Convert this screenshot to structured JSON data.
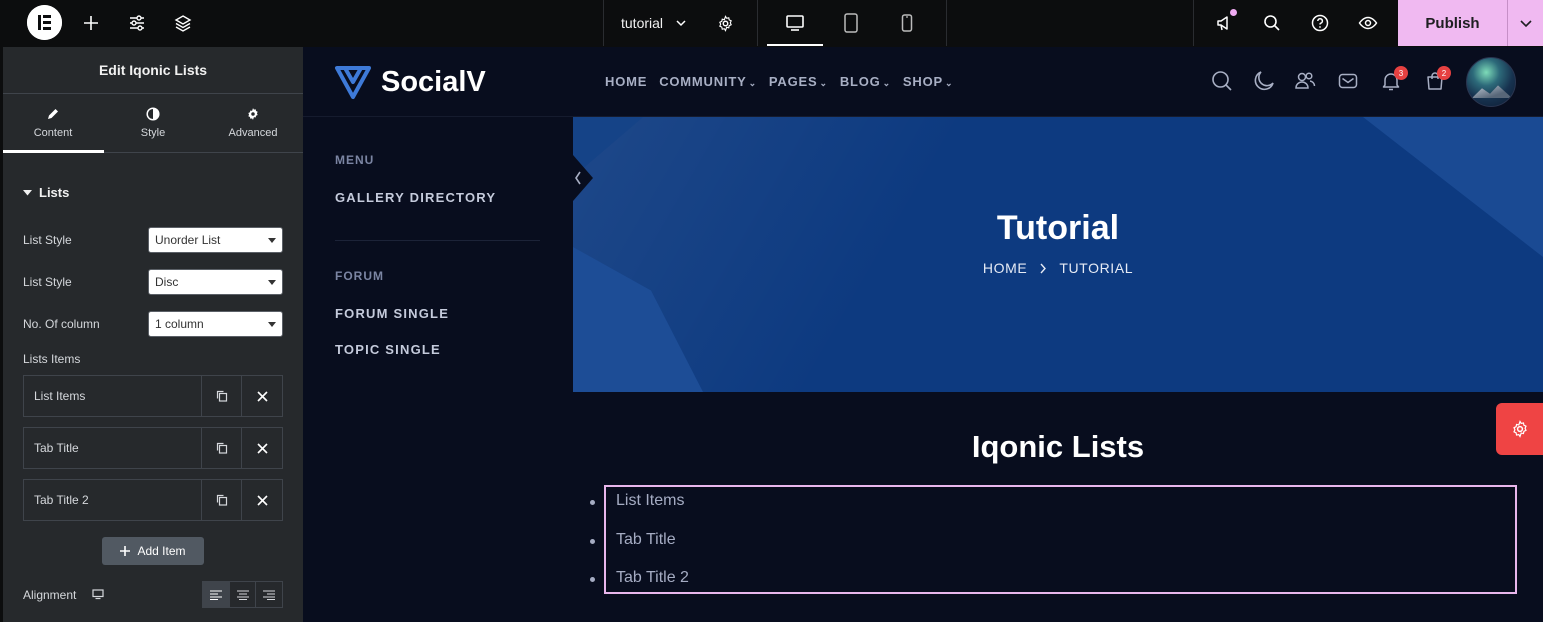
{
  "topbar": {
    "page_name": "tutorial",
    "publish_label": "Publish",
    "icons": [
      "elementor-logo-icon",
      "plus-icon",
      "sliders-icon",
      "layers-icon",
      "chevron-down-icon",
      "gear-icon",
      "desktop-icon",
      "tablet-icon",
      "mobile-icon",
      "megaphone-icon",
      "search-icon",
      "help-icon",
      "eye-icon"
    ]
  },
  "panel": {
    "title": "Edit Iqonic Lists",
    "tabs": [
      {
        "label": "Content",
        "icon": "pencil-icon"
      },
      {
        "label": "Style",
        "icon": "half-circle-icon"
      },
      {
        "label": "Advanced",
        "icon": "gear-icon"
      }
    ],
    "section": "Lists",
    "controls": [
      {
        "label": "List Style",
        "value": "Unorder List"
      },
      {
        "label": "List Style",
        "value": "Disc"
      },
      {
        "label": "No. Of column",
        "value": "1 column"
      }
    ],
    "items_label": "Lists Items",
    "items": [
      "List Items",
      "Tab Title",
      "Tab Title 2"
    ],
    "add_item_label": "Add Item",
    "alignment_label": "Alignment"
  },
  "site": {
    "brand": "SocialV",
    "nav": [
      "HOME",
      "COMMUNITY",
      "PAGES",
      "BLOG",
      "SHOP"
    ],
    "notification_count": "3",
    "cart_count": "2",
    "sidebar": {
      "menu_heading": "MENU",
      "menu_links": [
        "GALLERY DIRECTORY"
      ],
      "forum_heading": "FORUM",
      "forum_links": [
        "FORUM SINGLE",
        "TOPIC SINGLE"
      ]
    },
    "hero": {
      "title": "Tutorial",
      "crumb_home": "HOME",
      "crumb_current": "TUTORIAL"
    },
    "content_title": "Iqonic Lists",
    "list": [
      "List Items",
      "Tab Title",
      "Tab Title 2"
    ]
  },
  "colors": {
    "publish": "#f0b9f1",
    "panel_bg": "#26292c",
    "site_bg": "#080d1e",
    "hero_bg": "#0d3a80",
    "badge": "#e64141"
  }
}
